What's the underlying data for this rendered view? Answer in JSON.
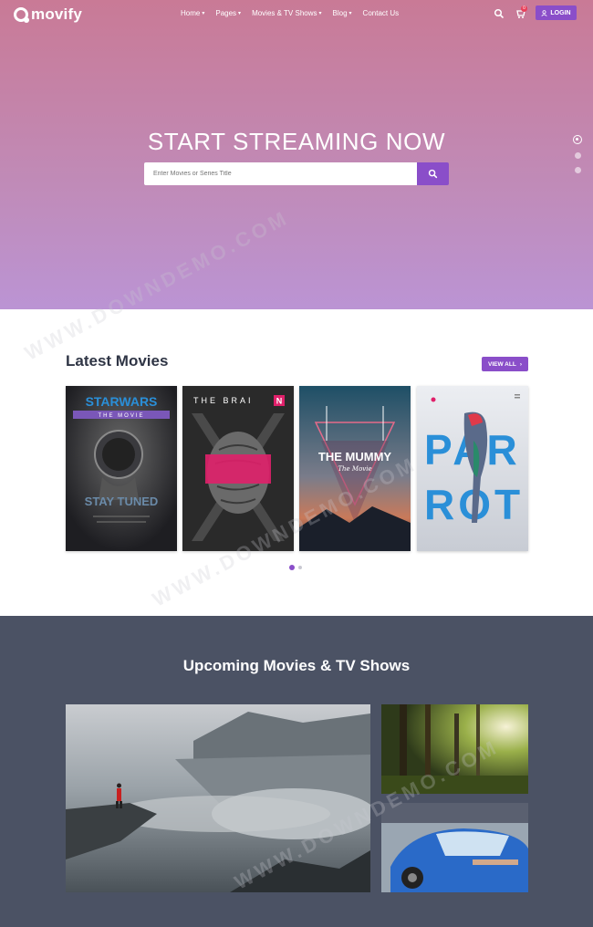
{
  "brand": {
    "name": "movify"
  },
  "nav": {
    "items": [
      {
        "label": "Home",
        "dropdown": true
      },
      {
        "label": "Pages",
        "dropdown": true
      },
      {
        "label": "Movies & TV Shows",
        "dropdown": true
      },
      {
        "label": "Blog",
        "dropdown": true
      },
      {
        "label": "Contact Us",
        "dropdown": false
      }
    ],
    "cart_count": "0",
    "login_label": "LOGIN"
  },
  "hero": {
    "title": "START STREAMING NOW",
    "search_placeholder": "Enter Movies or Series Title",
    "slides": 3,
    "active_slide": 1
  },
  "latest": {
    "title": "Latest Movies",
    "view_all_label": "VIEW ALL",
    "posters": [
      {
        "title": "STARWARS",
        "subtitle": "THE MOVIE",
        "tagline": "STAY TUNED"
      },
      {
        "title": "THE BRAI",
        "title_accent": "N"
      },
      {
        "title": "THE MUMMY",
        "subtitle": "The Movie"
      },
      {
        "title_line1": "PAR",
        "title_line2": "ROT"
      }
    ],
    "carousel_pages": 2,
    "active_page": 1
  },
  "upcoming": {
    "title": "Upcoming Movies & TV Shows",
    "images": [
      "mountain-lake",
      "forest",
      "car"
    ]
  },
  "colors": {
    "accent": "#8a4ec9",
    "hero_top": "#c97a96",
    "hero_bottom": "#bb94d4",
    "dark_section": "#4b5264",
    "heading": "#2f3545"
  },
  "watermark": "WWW.DOWNDEMO.COM"
}
